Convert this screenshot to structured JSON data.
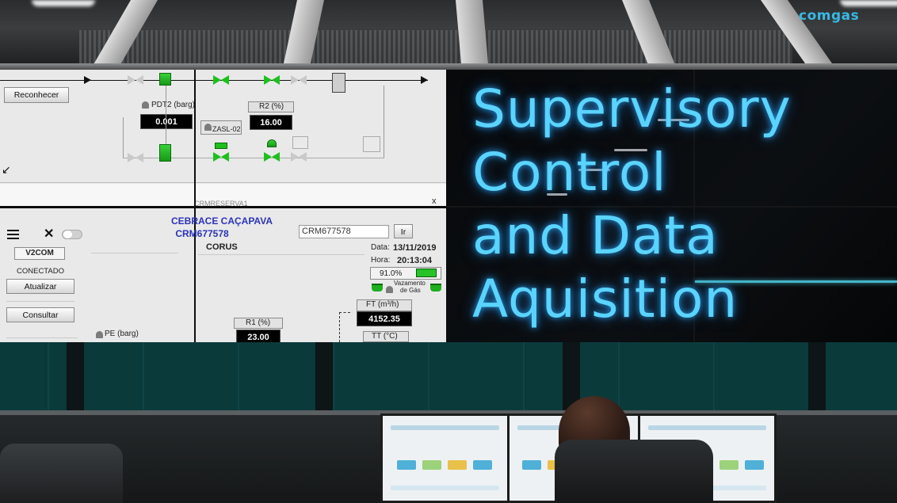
{
  "brand": {
    "logo_text": "comgas"
  },
  "headline": {
    "lines": [
      "Supervisory",
      "Control",
      "and Data",
      "Aquisition"
    ],
    "color": "#5ad4ff"
  },
  "scada": {
    "top_left": {
      "recognize_button": "Reconhecer",
      "pdt2_label": "PDT2 (barg)",
      "pdt2_value": "0.001",
      "r2_label": "R2   (%)",
      "r2_value": "16.00",
      "zasl_label": "ZASL-02",
      "footer_label": "CRMRESERVA1",
      "close_glyph": "x",
      "corner_glyph": "↙"
    },
    "bottom": {
      "station_title": "CEBRACE CAÇAPAVA",
      "station_code": "CRM677578",
      "search_value": "CRM677578",
      "go_button": "Ir",
      "v2com_label": "V2COM",
      "connected_label": "CONECTADO",
      "update_button": "Atualizar",
      "consult_button": "Consultar",
      "corus_label": "CORUS",
      "date_label": "Data:",
      "date_value": "13/11/2019",
      "time_label": "Hora:",
      "time_value": "20:13:04",
      "battery_value": "91.0%",
      "leak_label_1": "Vazamento",
      "leak_label_2": "de Gás",
      "ft_label": "FT    (m³/h)",
      "ft_value": "4152.35",
      "pe_label": "PE    (barg)",
      "r1_label": "R1    (%)",
      "r1_value": "23.00",
      "tt_label": "TT    (°C)"
    }
  },
  "colors": {
    "valve_green": "#1ec01e",
    "accent_cyan": "#46b5c8",
    "title_blue": "#2a33b8"
  }
}
